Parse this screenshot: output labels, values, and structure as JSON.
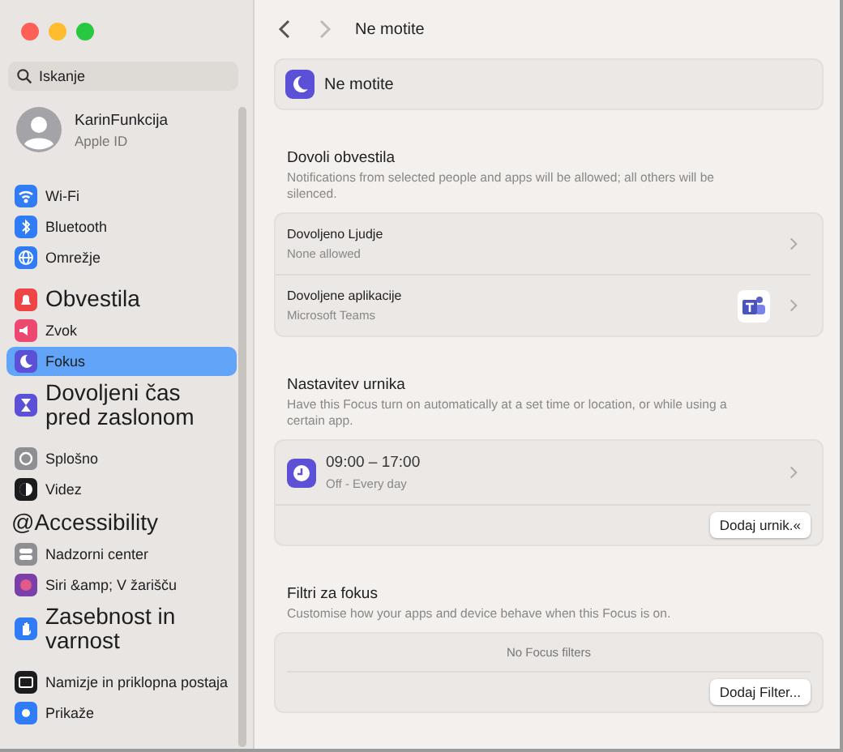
{
  "sidebar": {
    "search": {
      "placeholder": "Iskanje"
    },
    "profile": {
      "name": "KarinFunkcija",
      "subtitle": "Apple ID"
    },
    "groups": [
      [
        {
          "label": "Wi-Fi",
          "kind": "normal",
          "color": "#2f7cf6",
          "selected": false
        },
        {
          "label": "Bluetooth",
          "kind": "normal",
          "color": "#2f7cf6",
          "selected": false
        },
        {
          "label": "Omrežje",
          "kind": "normal",
          "color": "#2f7cf6",
          "selected": false
        }
      ],
      [
        {
          "label": "Obvestila",
          "kind": "large",
          "color": "#ef4444",
          "selected": false
        },
        {
          "label": "Zvok",
          "kind": "normal",
          "color": "#ec4870",
          "selected": false
        },
        {
          "label": "Fokus",
          "kind": "normal",
          "color": "#5b50d6",
          "selected": true
        },
        {
          "label": "Dovoljeni čas pred zaslonom",
          "kind": "large",
          "color": "#5b50d6",
          "selected": false
        }
      ],
      [
        {
          "label": "Splošno",
          "kind": "normal",
          "color": "#8e8e93",
          "selected": false
        },
        {
          "label": "Videz",
          "kind": "normal",
          "color": "#1c1c1e",
          "selected": false
        },
        {
          "label": "@Accessibility",
          "kind": "plain",
          "selected": false
        },
        {
          "label": "Nadzorni center",
          "kind": "normal",
          "color": "#8e8e93",
          "selected": false
        },
        {
          "label": "Siri &amp; V žarišču",
          "kind": "normal",
          "color": "#7a3fa8",
          "selected": false
        },
        {
          "label": "Zasebnost in varnost",
          "kind": "large",
          "color": "#2f7cf6",
          "selected": false
        }
      ],
      [
        {
          "label": "Namizje in priklopna postaja",
          "kind": "normal",
          "color": "#1c1c1e",
          "selected": false
        },
        {
          "label": "Prikaže",
          "kind": "normal",
          "color": "#2f7cf6",
          "selected": false
        }
      ]
    ]
  },
  "toolbar": {
    "title": "Ne motite"
  },
  "focus_card": {
    "title": "Ne motite"
  },
  "notifications": {
    "title": "Dovoli obvestila",
    "description": "Notifications from selected people and apps will be allowed; all others will be silenced.",
    "rows": [
      {
        "title": "Dovoljeno Ljudje",
        "subtitle": "None allowed",
        "kind": "plain"
      },
      {
        "title": "Dovoljene aplikacije",
        "subtitle": "Microsoft Teams",
        "kind": "app"
      }
    ]
  },
  "schedule": {
    "title": "Nastavitev urnika",
    "description": "Have this Focus turn on automatically at a set time or location, or while using a certain app.",
    "item": {
      "time": "09:00 – 17:00",
      "subtitle": "Off - Every day"
    },
    "button": "Dodaj urnik.«"
  },
  "filters": {
    "title": "Filtri za fokus",
    "description": "Customise how your apps and device behave when this Focus is on.",
    "empty": "No Focus filters",
    "button": "Dodaj Filter..."
  }
}
